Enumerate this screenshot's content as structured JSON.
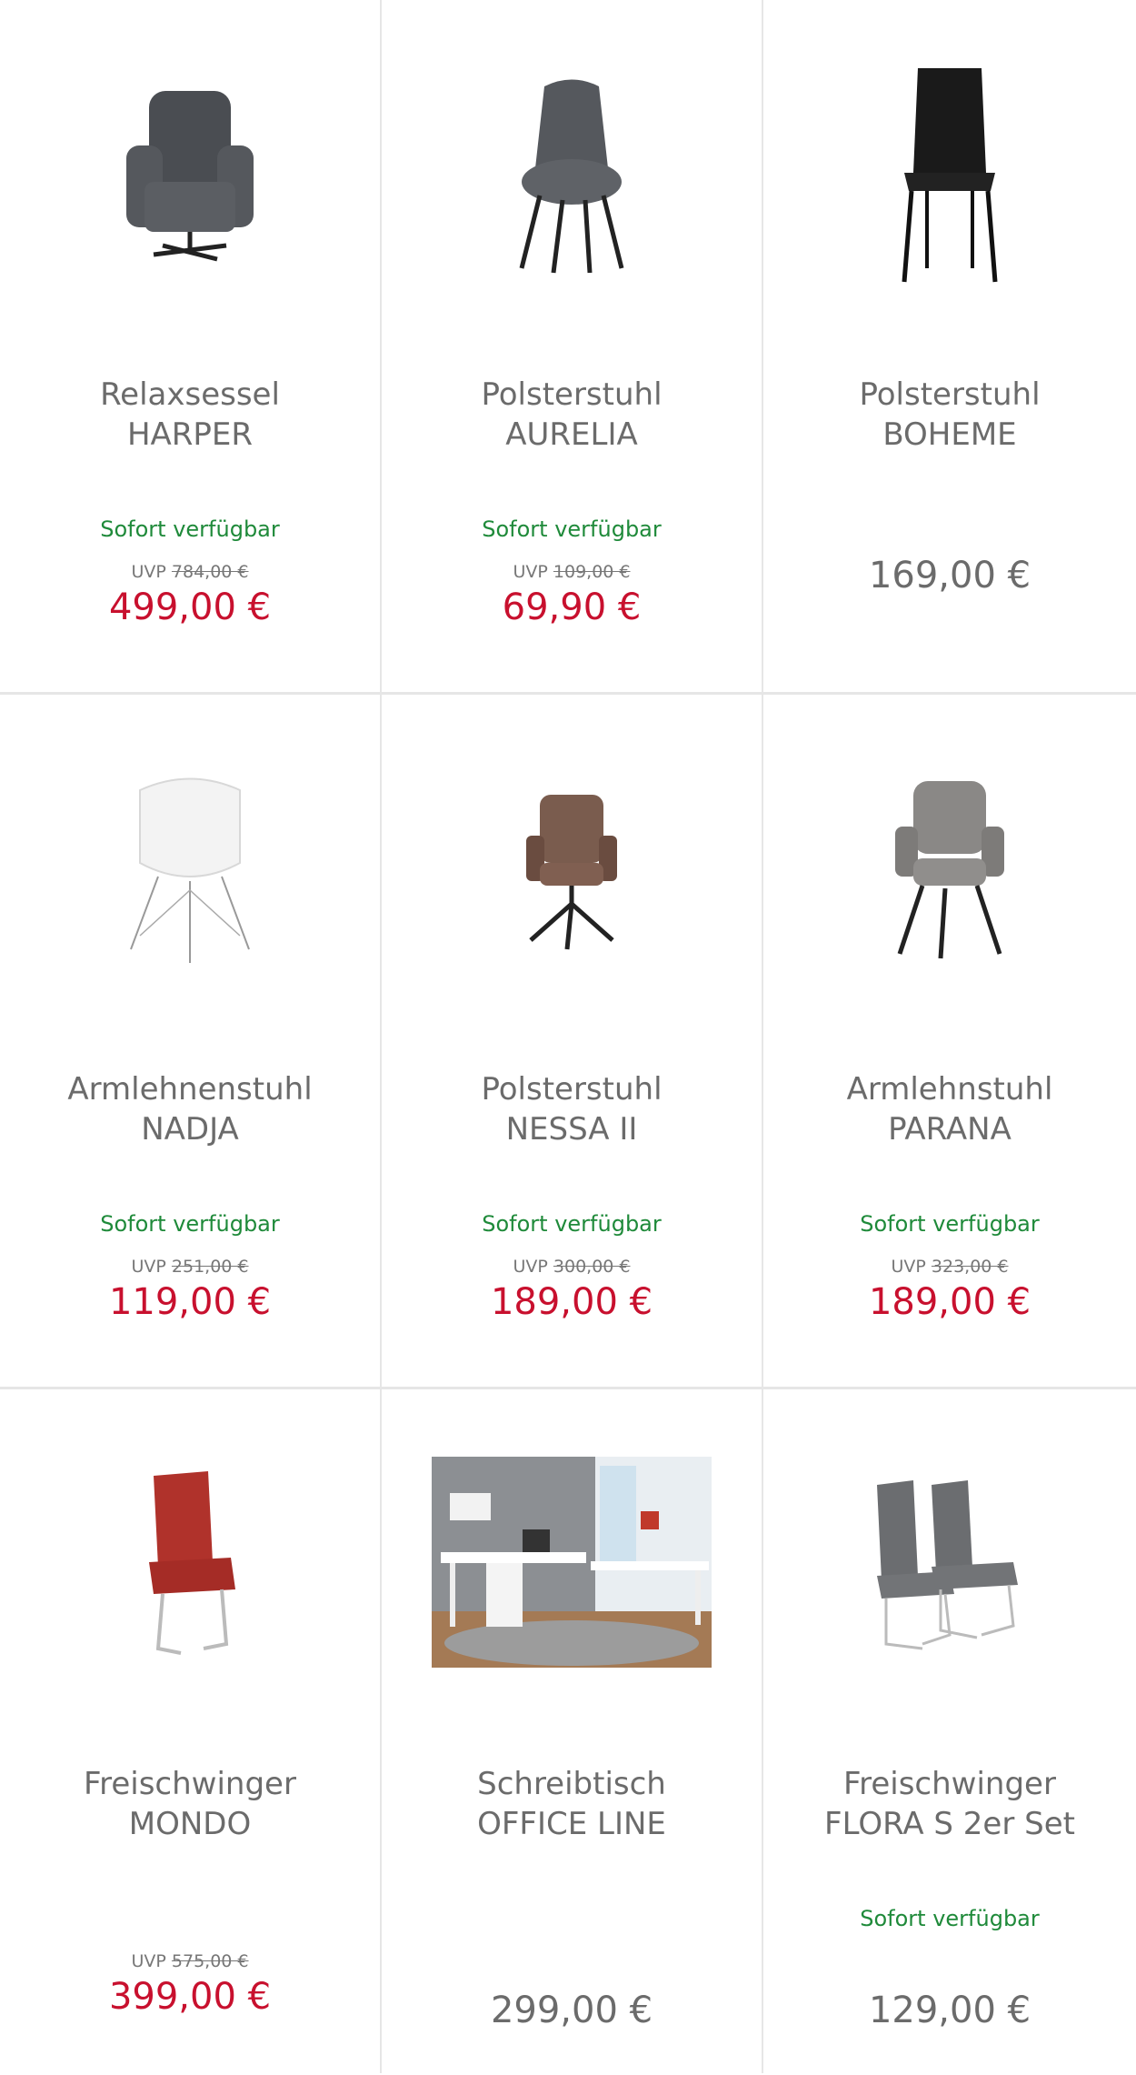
{
  "products": [
    {
      "line1": "Relaxsessel",
      "line2": "HARPER",
      "availability": "Sofort verfügbar",
      "uvp_label": "UVP",
      "uvp_price": "784,00 €",
      "price": "499,00 €",
      "icon": "armchair-icon"
    },
    {
      "line1": "Polsterstuhl",
      "line2": "AURELIA",
      "availability": "Sofort verfügbar",
      "uvp_label": "UVP",
      "uvp_price": "109,00 €",
      "price": "69,90 €",
      "icon": "chair-icon"
    },
    {
      "line1": "Polsterstuhl",
      "line2": "BOHEME",
      "availability": "",
      "uvp_label": "",
      "uvp_price": "",
      "price": "169,00 €",
      "icon": "chair-icon"
    },
    {
      "line1": "Armlehnenstuhl",
      "line2": "NADJA",
      "availability": "Sofort verfügbar",
      "uvp_label": "UVP",
      "uvp_price": "251,00 €",
      "price": "119,00 €",
      "icon": "chair-icon"
    },
    {
      "line1": "Polsterstuhl",
      "line2": "NESSA II",
      "availability": "Sofort verfügbar",
      "uvp_label": "UVP",
      "uvp_price": "300,00 €",
      "price": "189,00 €",
      "icon": "chair-icon"
    },
    {
      "line1": "Armlehnstuhl",
      "line2": "PARANA",
      "availability": "Sofort verfügbar",
      "uvp_label": "UVP",
      "uvp_price": "323,00 €",
      "price": "189,00 €",
      "icon": "chair-icon"
    },
    {
      "line1": "Freischwinger",
      "line2": "MONDO",
      "availability": "",
      "uvp_label": "UVP",
      "uvp_price": "575,00 €",
      "price": "399,00 €",
      "icon": "cantilever-chair-icon"
    },
    {
      "line1": "Schreibtisch",
      "line2": "OFFICE LINE",
      "availability": "",
      "uvp_label": "",
      "uvp_price": "",
      "price": "299,00 €",
      "icon": "desk-icon"
    },
    {
      "line1": "Freischwinger",
      "line2": "FLORA S 2er Set",
      "availability": "Sofort verfügbar",
      "uvp_label": "",
      "uvp_price": "",
      "price": "129,00 €",
      "icon": "cantilever-chair-icon"
    }
  ],
  "colors": {
    "sale_price": "#c8102e",
    "availability": "#1f8a3a",
    "text": "#6b6b6b",
    "divider": "#e6e6e6"
  }
}
